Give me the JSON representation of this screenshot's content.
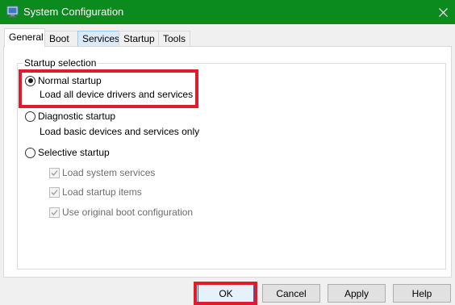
{
  "window": {
    "title": "System Configuration",
    "title_icon": "msconfig-icon",
    "close_icon": "close-icon",
    "titlebar_color": "#0b8a1e"
  },
  "tabs": [
    {
      "label": "General",
      "active": true
    },
    {
      "label": "Boot"
    },
    {
      "label": "Services"
    },
    {
      "label": "Startup"
    },
    {
      "label": "Tools"
    }
  ],
  "startup_selection": {
    "legend": "Startup selection",
    "normal": {
      "label": "Normal startup",
      "description": "Load all device drivers and services",
      "checked": true
    },
    "diagnostic": {
      "label": "Diagnostic startup",
      "description": "Load basic devices and services only",
      "checked": false
    },
    "selective": {
      "label": "Selective startup",
      "checked": false,
      "options": [
        {
          "label": "Load system services",
          "checked": true,
          "disabled": true
        },
        {
          "label": "Load startup items",
          "checked": true,
          "disabled": true
        },
        {
          "label": "Use original boot configuration",
          "checked": true,
          "disabled": true
        }
      ]
    }
  },
  "buttons": {
    "ok": "OK",
    "cancel": "Cancel",
    "apply": "Apply",
    "help": "Help"
  },
  "highlight_color": "#e01c2a"
}
